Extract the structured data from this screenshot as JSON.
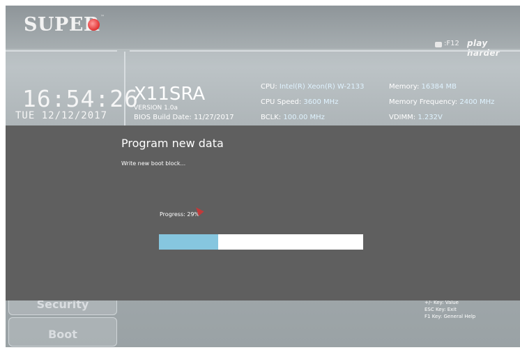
{
  "header": {
    "logo_text": "SUPER",
    "logo_tm": "™",
    "f12_text": ":F12",
    "tagline": "play harder"
  },
  "clock": {
    "time": "16:54:26",
    "date": "TUE 12/12/2017"
  },
  "board": {
    "model": "X11SRA",
    "version": "VERSION 1.0a",
    "build_date": "BIOS Build Date: 11/27/2017"
  },
  "system_info": {
    "cpu_label": "CPU:",
    "cpu_value": "Intel(R) Xeon(R) W-2133",
    "cpu_speed_label": "CPU Speed:",
    "cpu_speed_value": "3600 MHz",
    "bclk_label": "BCLK:",
    "bclk_value": "100.00 MHz",
    "memory_label": "Memory:",
    "memory_value": "16384 MB",
    "mem_freq_label": "Memory Frequency:",
    "mem_freq_value": "2400 MHz",
    "vdimm_label": "VDIMM:",
    "vdimm_value": "1.232V"
  },
  "nav": {
    "security": "Security",
    "boot": "Boot"
  },
  "help": {
    "line1": "+/- Key: Value",
    "line2": "ESC Key: Exit",
    "line3": "F1 Key: General Help"
  },
  "dialog": {
    "title": "Program new data",
    "message": "Write new boot block...",
    "progress_text": "Progress: 29%",
    "progress_percent": 29
  },
  "colors": {
    "dialog_bg": "#5f5f5f",
    "progress_fill": "#86c6df",
    "logo_dot": "#e03030"
  },
  "icons": {
    "camera": "camera-icon",
    "cursor": "mouse-cursor-icon"
  }
}
